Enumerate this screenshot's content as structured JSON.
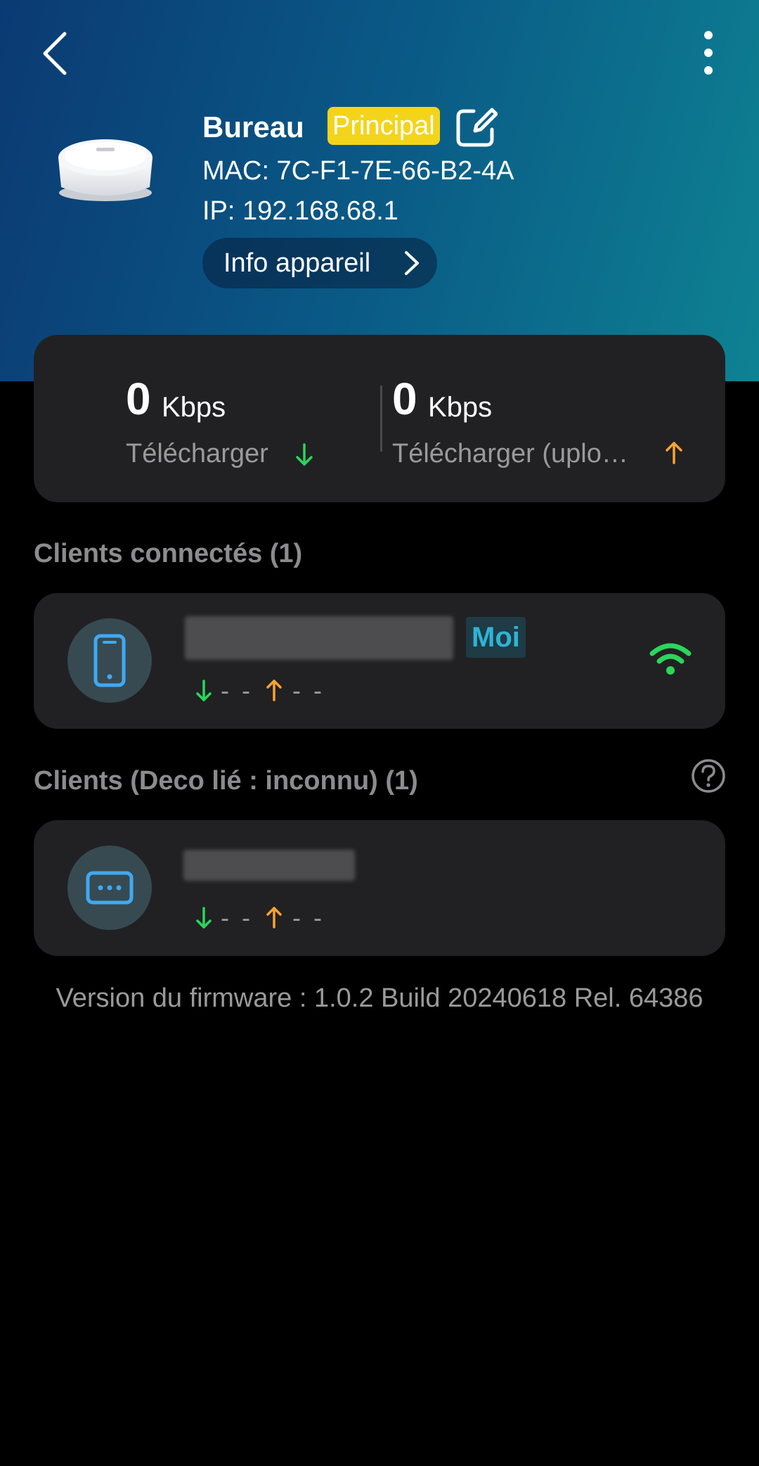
{
  "header": {
    "device_name": "Bureau",
    "main_badge": "Principal",
    "mac": "MAC: 7C-F1-7E-66-B2-4A",
    "ip": "IP: 192.168.68.1",
    "info_button_label": "Info appareil",
    "background_colors": [
      "#0b3a73",
      "#0e8293"
    ]
  },
  "speed": {
    "download": {
      "value": "0",
      "unit": "Kbps",
      "label": "Télécharger",
      "arrow_color": "#2bd65b"
    },
    "upload": {
      "value": "0",
      "unit": "Kbps",
      "label": "Télécharger (uplo…",
      "arrow_color": "#f7a233"
    }
  },
  "connected_clients": {
    "title": "Clients connectés (1)",
    "items": [
      {
        "icon": "phone-icon",
        "badge": "Moi",
        "download": "- -",
        "upload": "- -",
        "signal": "wifi-icon"
      }
    ]
  },
  "unknown_clients": {
    "title": "Clients (Deco lié : inconnu) (1)",
    "items": [
      {
        "icon": "device-icon",
        "download": "- -",
        "upload": "- -"
      }
    ]
  },
  "firmware": {
    "text": "Version du firmware : 1.0.2 Build 20240618 Rel. 64386"
  },
  "colors": {
    "accent_green": "#2bd65b",
    "accent_orange": "#f7a233",
    "badge_yellow": "#f4d41a",
    "me_badge_text": "#2fb3d5",
    "card_bg": "#212123"
  }
}
